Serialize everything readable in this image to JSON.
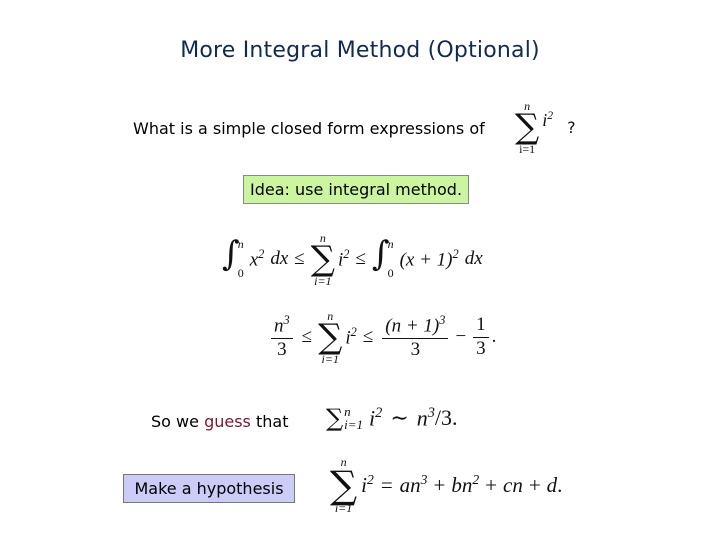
{
  "slide": {
    "title": "More Integral Method (Optional)",
    "question": {
      "text": "What is a simple closed form expressions of",
      "sum_upper": "n",
      "sum_lower": "i=1",
      "summand_base": "i",
      "summand_exp": "2",
      "suffix": "?"
    },
    "idea_box": {
      "label": "Idea: use integral method.",
      "color": "#ccf5a0"
    },
    "inequality1": {
      "int_lower": "0",
      "int_upper": "n",
      "left_integrand_base": "x",
      "left_integrand_exp": "2",
      "dx": "dx",
      "leq": "≤",
      "sum_upper": "n",
      "sum_lower": "i=1",
      "summand_base": "i",
      "summand_exp": "2",
      "right_integrand": "(x + 1)",
      "right_integrand_exp": "2"
    },
    "inequality2": {
      "left_num_base": "n",
      "left_num_exp": "3",
      "left_den": "3",
      "leq": "≤",
      "sum_upper": "n",
      "sum_lower": "i=1",
      "summand_base": "i",
      "summand_exp": "2",
      "right_num": "(n + 1)",
      "right_num_exp": "3",
      "right_den": "3",
      "minus": "−",
      "last_num": "1",
      "last_den": "3",
      "period": "."
    },
    "guess": {
      "prefix": "So we",
      "highlight": "guess",
      "suffix": "that",
      "highlight_color": "#7a1530",
      "sum_upper": "n",
      "sum_lower": "i=1",
      "summand_base": "i",
      "summand_exp": "2",
      "rel": "∼",
      "rhs_base": "n",
      "rhs_exp": "3",
      "rhs_tail": "/3."
    },
    "hypothesis_box": {
      "label": "Make a hypothesis",
      "color": "#ccccf8"
    },
    "hypothesis": {
      "sum_upper": "n",
      "sum_lower": "i=1",
      "summand_base": "i",
      "summand_exp": "2",
      "rhs": [
        {
          "coef": "a",
          "var": "n",
          "exp": "3"
        },
        {
          "coef": "b",
          "var": "n",
          "exp": "2"
        },
        {
          "coef": "c",
          "var": "n",
          "exp": ""
        },
        {
          "coef": "d",
          "var": "",
          "exp": ""
        }
      ],
      "equals": "=",
      "plus": "+",
      "period": "."
    }
  }
}
